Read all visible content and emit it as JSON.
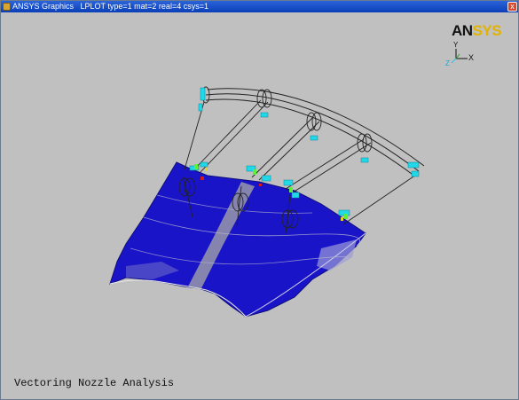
{
  "window": {
    "title": "ANSYS Graphics",
    "plot_info": "LPLOT  type=1 mat=2 real=4 csys=1",
    "close_symbol": "x"
  },
  "logo": {
    "part1": "AN",
    "part2": "SYS",
    "color_part1": "#111111",
    "color_part2": "#e2b300"
  },
  "triad": {
    "x_label": "X",
    "z_label": "Z",
    "y_label": "Y"
  },
  "caption": "Vectoring Nozzle Analysis",
  "colors": {
    "background": "#c0c0c0",
    "shell": "#1a14c8",
    "constraint": "#20d8e8",
    "title_bar": "#0a3fb8"
  }
}
